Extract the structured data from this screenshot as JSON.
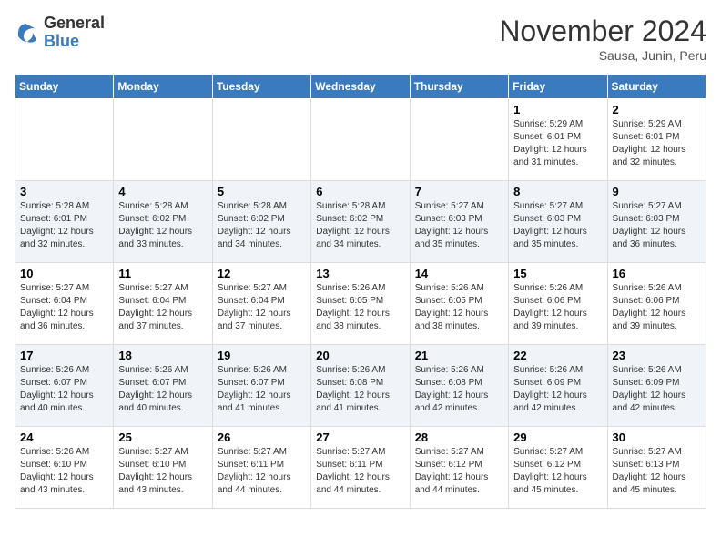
{
  "header": {
    "logo_line1": "General",
    "logo_line2": "Blue",
    "month": "November 2024",
    "location": "Sausa, Junin, Peru"
  },
  "weekdays": [
    "Sunday",
    "Monday",
    "Tuesday",
    "Wednesday",
    "Thursday",
    "Friday",
    "Saturday"
  ],
  "weeks": [
    [
      {
        "day": "",
        "info": ""
      },
      {
        "day": "",
        "info": ""
      },
      {
        "day": "",
        "info": ""
      },
      {
        "day": "",
        "info": ""
      },
      {
        "day": "",
        "info": ""
      },
      {
        "day": "1",
        "info": "Sunrise: 5:29 AM\nSunset: 6:01 PM\nDaylight: 12 hours\nand 31 minutes."
      },
      {
        "day": "2",
        "info": "Sunrise: 5:29 AM\nSunset: 6:01 PM\nDaylight: 12 hours\nand 32 minutes."
      }
    ],
    [
      {
        "day": "3",
        "info": "Sunrise: 5:28 AM\nSunset: 6:01 PM\nDaylight: 12 hours\nand 32 minutes."
      },
      {
        "day": "4",
        "info": "Sunrise: 5:28 AM\nSunset: 6:02 PM\nDaylight: 12 hours\nand 33 minutes."
      },
      {
        "day": "5",
        "info": "Sunrise: 5:28 AM\nSunset: 6:02 PM\nDaylight: 12 hours\nand 34 minutes."
      },
      {
        "day": "6",
        "info": "Sunrise: 5:28 AM\nSunset: 6:02 PM\nDaylight: 12 hours\nand 34 minutes."
      },
      {
        "day": "7",
        "info": "Sunrise: 5:27 AM\nSunset: 6:03 PM\nDaylight: 12 hours\nand 35 minutes."
      },
      {
        "day": "8",
        "info": "Sunrise: 5:27 AM\nSunset: 6:03 PM\nDaylight: 12 hours\nand 35 minutes."
      },
      {
        "day": "9",
        "info": "Sunrise: 5:27 AM\nSunset: 6:03 PM\nDaylight: 12 hours\nand 36 minutes."
      }
    ],
    [
      {
        "day": "10",
        "info": "Sunrise: 5:27 AM\nSunset: 6:04 PM\nDaylight: 12 hours\nand 36 minutes."
      },
      {
        "day": "11",
        "info": "Sunrise: 5:27 AM\nSunset: 6:04 PM\nDaylight: 12 hours\nand 37 minutes."
      },
      {
        "day": "12",
        "info": "Sunrise: 5:27 AM\nSunset: 6:04 PM\nDaylight: 12 hours\nand 37 minutes."
      },
      {
        "day": "13",
        "info": "Sunrise: 5:26 AM\nSunset: 6:05 PM\nDaylight: 12 hours\nand 38 minutes."
      },
      {
        "day": "14",
        "info": "Sunrise: 5:26 AM\nSunset: 6:05 PM\nDaylight: 12 hours\nand 38 minutes."
      },
      {
        "day": "15",
        "info": "Sunrise: 5:26 AM\nSunset: 6:06 PM\nDaylight: 12 hours\nand 39 minutes."
      },
      {
        "day": "16",
        "info": "Sunrise: 5:26 AM\nSunset: 6:06 PM\nDaylight: 12 hours\nand 39 minutes."
      }
    ],
    [
      {
        "day": "17",
        "info": "Sunrise: 5:26 AM\nSunset: 6:07 PM\nDaylight: 12 hours\nand 40 minutes."
      },
      {
        "day": "18",
        "info": "Sunrise: 5:26 AM\nSunset: 6:07 PM\nDaylight: 12 hours\nand 40 minutes."
      },
      {
        "day": "19",
        "info": "Sunrise: 5:26 AM\nSunset: 6:07 PM\nDaylight: 12 hours\nand 41 minutes."
      },
      {
        "day": "20",
        "info": "Sunrise: 5:26 AM\nSunset: 6:08 PM\nDaylight: 12 hours\nand 41 minutes."
      },
      {
        "day": "21",
        "info": "Sunrise: 5:26 AM\nSunset: 6:08 PM\nDaylight: 12 hours\nand 42 minutes."
      },
      {
        "day": "22",
        "info": "Sunrise: 5:26 AM\nSunset: 6:09 PM\nDaylight: 12 hours\nand 42 minutes."
      },
      {
        "day": "23",
        "info": "Sunrise: 5:26 AM\nSunset: 6:09 PM\nDaylight: 12 hours\nand 42 minutes."
      }
    ],
    [
      {
        "day": "24",
        "info": "Sunrise: 5:26 AM\nSunset: 6:10 PM\nDaylight: 12 hours\nand 43 minutes."
      },
      {
        "day": "25",
        "info": "Sunrise: 5:27 AM\nSunset: 6:10 PM\nDaylight: 12 hours\nand 43 minutes."
      },
      {
        "day": "26",
        "info": "Sunrise: 5:27 AM\nSunset: 6:11 PM\nDaylight: 12 hours\nand 44 minutes."
      },
      {
        "day": "27",
        "info": "Sunrise: 5:27 AM\nSunset: 6:11 PM\nDaylight: 12 hours\nand 44 minutes."
      },
      {
        "day": "28",
        "info": "Sunrise: 5:27 AM\nSunset: 6:12 PM\nDaylight: 12 hours\nand 44 minutes."
      },
      {
        "day": "29",
        "info": "Sunrise: 5:27 AM\nSunset: 6:12 PM\nDaylight: 12 hours\nand 45 minutes."
      },
      {
        "day": "30",
        "info": "Sunrise: 5:27 AM\nSunset: 6:13 PM\nDaylight: 12 hours\nand 45 minutes."
      }
    ]
  ]
}
